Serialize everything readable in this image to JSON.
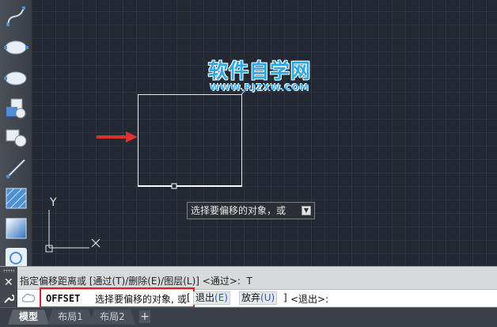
{
  "watermark": {
    "title": "软件自学网",
    "url": "WWW.RJZXW.COM"
  },
  "tooltip": {
    "text": "选择要偏移的对象，或"
  },
  "ucs": {
    "y_label": "Y"
  },
  "command": {
    "history": "指定偏移距离或 [通过(T)/删除(E)/图层(L)] <通过>:  T",
    "name": "OFFSET",
    "prompt": "选择要偏移的对象,",
    "or": "或",
    "bracket_left": "[",
    "options": [
      {
        "text": "退出",
        "key": "(E)"
      },
      {
        "text": "放弃",
        "key": "(U)"
      }
    ],
    "bracket_right": "]",
    "default": "<退出>:"
  },
  "tabs": [
    {
      "label": "模型",
      "active": true
    },
    {
      "label": "布局1",
      "active": false
    },
    {
      "label": "布局2",
      "active": false
    }
  ],
  "tab_add": "+",
  "colors": {
    "arrow": "#e03030",
    "highlight": "#e02020",
    "watermark": "#2ba8e8"
  },
  "icons": [
    "spline-icon",
    "ellipse-icon",
    "ellipse-icon",
    "block-icon",
    "insert-block-icon",
    "line-icon",
    "hatch-icon",
    "gradient-icon",
    "region-icon"
  ]
}
